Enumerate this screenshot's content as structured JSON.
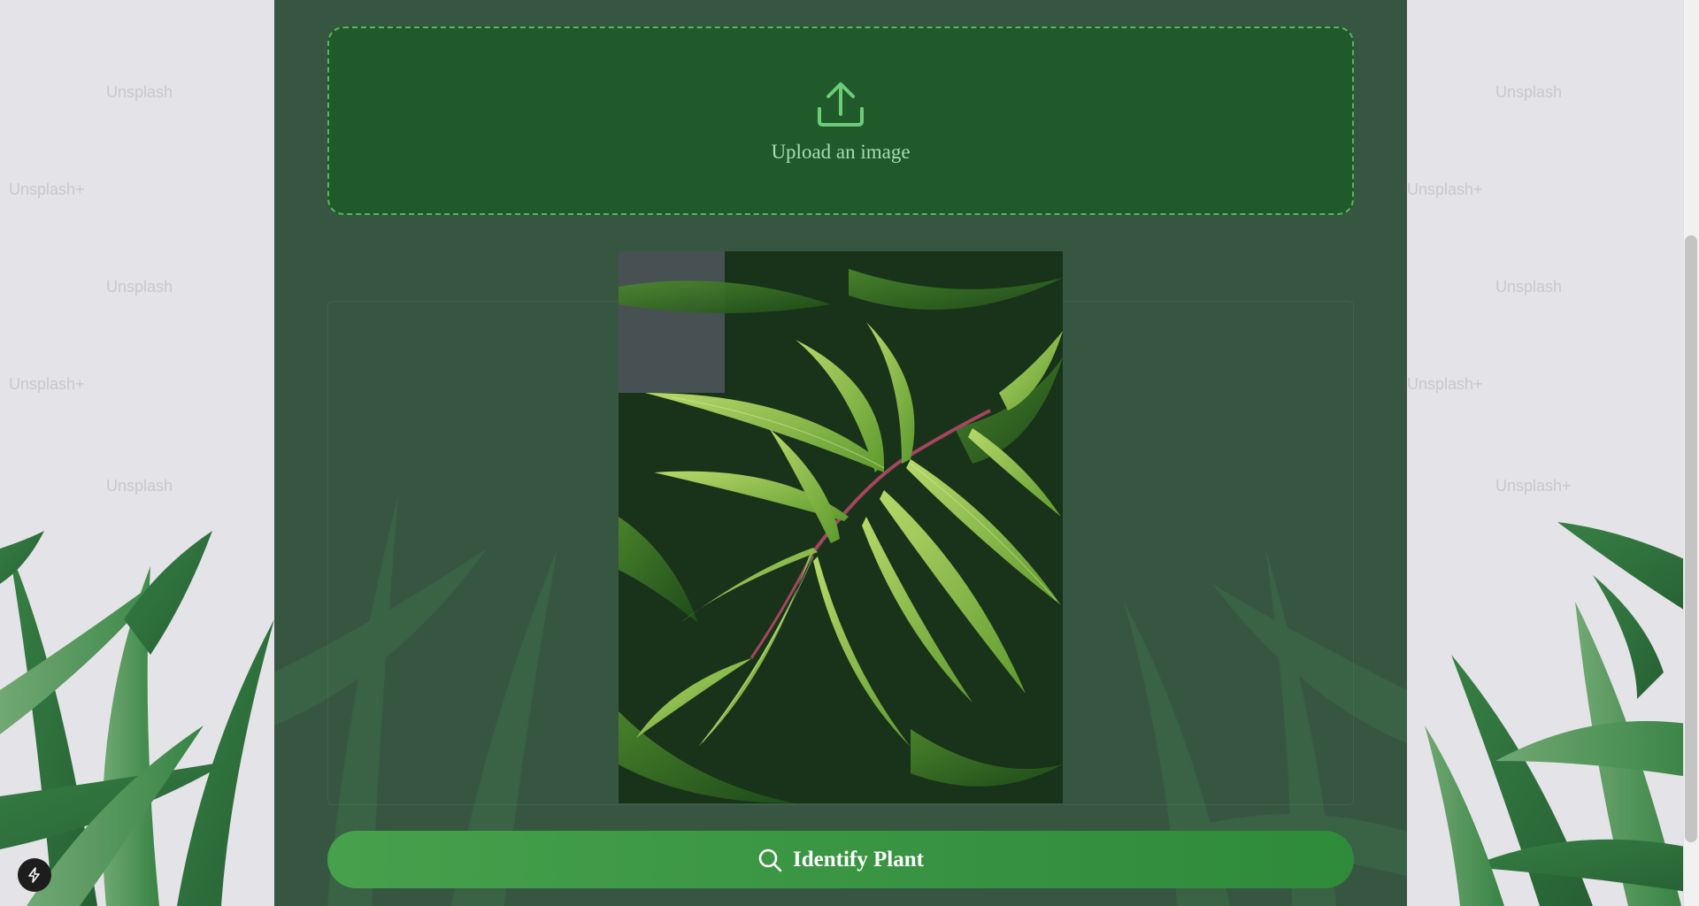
{
  "upload": {
    "label": "Upload an image",
    "icon": "upload-icon"
  },
  "preview": {
    "icon": "plant-photo"
  },
  "identify_button": {
    "label": "Identify Plant",
    "icon": "search-icon"
  },
  "dev_tools": {
    "icon": "lightning-bolt-icon"
  },
  "colors": {
    "panel": "#2a4b34",
    "upload_bg": "#215a2a",
    "upload_border": "#56b464",
    "upload_text": "#a6dfae",
    "button": "#3a9643",
    "page_bg": "#e4e3e7"
  }
}
